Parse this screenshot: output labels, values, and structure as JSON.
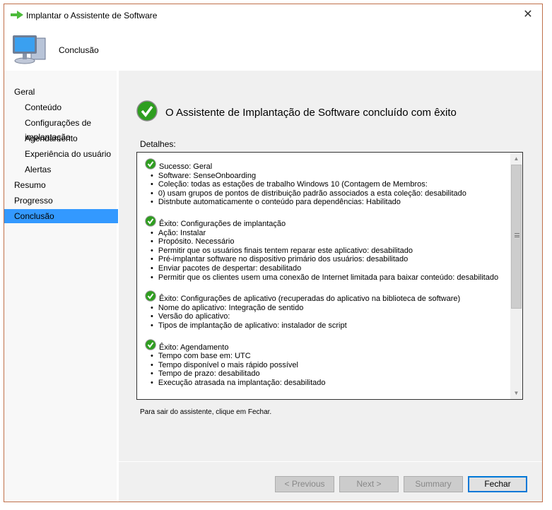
{
  "window": {
    "title": "Implantar o Assistente de Software",
    "close_label": "✕"
  },
  "header": {
    "title": "Conclusão"
  },
  "sidebar": {
    "items": [
      {
        "label": "Geral",
        "level": 0
      },
      {
        "label": "Conteúdo",
        "level": 1
      },
      {
        "label": "Configurações de implantação",
        "level": 1
      },
      {
        "label": "Agendamento",
        "level": 1
      },
      {
        "label": "Experiência do usuário",
        "level": 1
      },
      {
        "label": "Alertas",
        "level": 1
      },
      {
        "label": "Resumo",
        "level": 0
      },
      {
        "label": "Progresso",
        "level": 0
      },
      {
        "label": "Conclusão",
        "level": 0,
        "selected": true
      }
    ]
  },
  "main": {
    "heading": "O Assistente de Implantação de Software concluído com êxito",
    "details_label": "Detalhes:",
    "sections": [
      {
        "title": "Sucesso: Geral",
        "items": [
          "Software: SenseOnboarding",
          "Coleção: todas as estações de trabalho Windows 10 (Contagem de Membros:",
          "0) usam grupos de pontos de distribuição padrão associados a esta coleção: desabilitado",
          "Distnbute automaticamente o conteúdo para dependências: Habilitado"
        ]
      },
      {
        "title": "Êxito: Configurações de implantação",
        "items": [
          "Ação: Instalar",
          "Propósito. Necessário",
          "Permitir que os usuários finais tentem reparar este aplicativo: desabilitado",
          "Pré-implantar software no dispositivo primário dos usuários: desabilitado",
          "Enviar pacotes de despertar: desabilitado",
          "Permitir que os clientes usem uma conexão de Internet limitada para baixar conteúdo: desabilitado"
        ]
      },
      {
        "title": "Êxito: Configurações de aplicativo (recuperadas do aplicativo na biblioteca de software)",
        "items": [
          "Nome do aplicativo: Integração de sentido",
          "Versão do aplicativo:",
          "Tipos de implantação de aplicativo: instalador de script"
        ]
      },
      {
        "title": "Êxito: Agendamento",
        "items": [
          "Tempo com base em: UTC",
          "Tempo disponível o mais rápido possível",
          "Tempo de prazo: desabilitado",
          "Execução atrasada na implantação: desabilitado"
        ]
      }
    ],
    "exit_hint": "Para sair do assistente, clique em Fechar."
  },
  "buttons": {
    "previous": "< Previous",
    "next": "Next >",
    "summary": "Summary",
    "close": "Fechar"
  },
  "colors": {
    "selection": "#3399ff",
    "accent": "#0078d7",
    "success": "#2e9e1f"
  }
}
